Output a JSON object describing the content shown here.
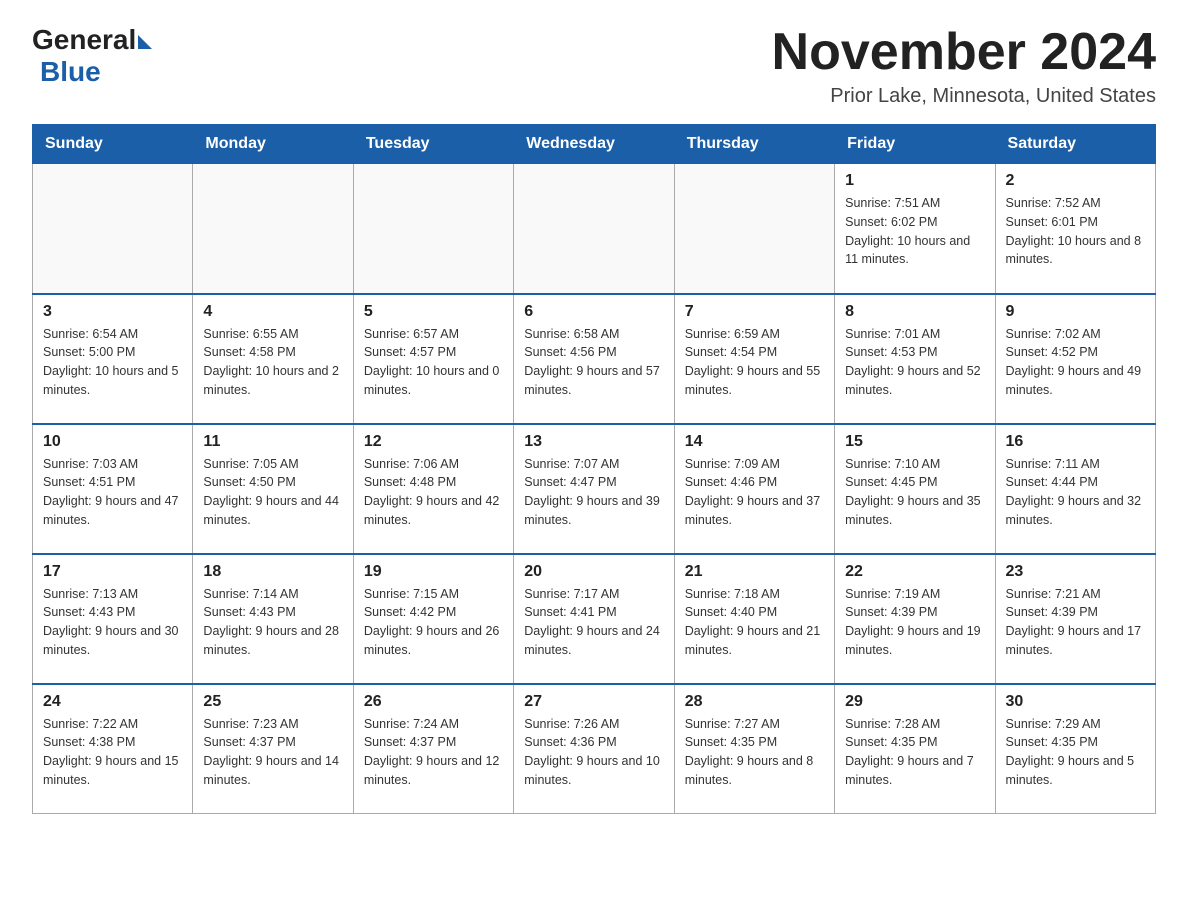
{
  "logo": {
    "general": "General",
    "blue": "Blue"
  },
  "title": "November 2024",
  "location": "Prior Lake, Minnesota, United States",
  "weekdays": [
    "Sunday",
    "Monday",
    "Tuesday",
    "Wednesday",
    "Thursday",
    "Friday",
    "Saturday"
  ],
  "weeks": [
    [
      {
        "day": "",
        "sunrise": "",
        "sunset": "",
        "daylight": ""
      },
      {
        "day": "",
        "sunrise": "",
        "sunset": "",
        "daylight": ""
      },
      {
        "day": "",
        "sunrise": "",
        "sunset": "",
        "daylight": ""
      },
      {
        "day": "",
        "sunrise": "",
        "sunset": "",
        "daylight": ""
      },
      {
        "day": "",
        "sunrise": "",
        "sunset": "",
        "daylight": ""
      },
      {
        "day": "1",
        "sunrise": "Sunrise: 7:51 AM",
        "sunset": "Sunset: 6:02 PM",
        "daylight": "Daylight: 10 hours and 11 minutes."
      },
      {
        "day": "2",
        "sunrise": "Sunrise: 7:52 AM",
        "sunset": "Sunset: 6:01 PM",
        "daylight": "Daylight: 10 hours and 8 minutes."
      }
    ],
    [
      {
        "day": "3",
        "sunrise": "Sunrise: 6:54 AM",
        "sunset": "Sunset: 5:00 PM",
        "daylight": "Daylight: 10 hours and 5 minutes."
      },
      {
        "day": "4",
        "sunrise": "Sunrise: 6:55 AM",
        "sunset": "Sunset: 4:58 PM",
        "daylight": "Daylight: 10 hours and 2 minutes."
      },
      {
        "day": "5",
        "sunrise": "Sunrise: 6:57 AM",
        "sunset": "Sunset: 4:57 PM",
        "daylight": "Daylight: 10 hours and 0 minutes."
      },
      {
        "day": "6",
        "sunrise": "Sunrise: 6:58 AM",
        "sunset": "Sunset: 4:56 PM",
        "daylight": "Daylight: 9 hours and 57 minutes."
      },
      {
        "day": "7",
        "sunrise": "Sunrise: 6:59 AM",
        "sunset": "Sunset: 4:54 PM",
        "daylight": "Daylight: 9 hours and 55 minutes."
      },
      {
        "day": "8",
        "sunrise": "Sunrise: 7:01 AM",
        "sunset": "Sunset: 4:53 PM",
        "daylight": "Daylight: 9 hours and 52 minutes."
      },
      {
        "day": "9",
        "sunrise": "Sunrise: 7:02 AM",
        "sunset": "Sunset: 4:52 PM",
        "daylight": "Daylight: 9 hours and 49 minutes."
      }
    ],
    [
      {
        "day": "10",
        "sunrise": "Sunrise: 7:03 AM",
        "sunset": "Sunset: 4:51 PM",
        "daylight": "Daylight: 9 hours and 47 minutes."
      },
      {
        "day": "11",
        "sunrise": "Sunrise: 7:05 AM",
        "sunset": "Sunset: 4:50 PM",
        "daylight": "Daylight: 9 hours and 44 minutes."
      },
      {
        "day": "12",
        "sunrise": "Sunrise: 7:06 AM",
        "sunset": "Sunset: 4:48 PM",
        "daylight": "Daylight: 9 hours and 42 minutes."
      },
      {
        "day": "13",
        "sunrise": "Sunrise: 7:07 AM",
        "sunset": "Sunset: 4:47 PM",
        "daylight": "Daylight: 9 hours and 39 minutes."
      },
      {
        "day": "14",
        "sunrise": "Sunrise: 7:09 AM",
        "sunset": "Sunset: 4:46 PM",
        "daylight": "Daylight: 9 hours and 37 minutes."
      },
      {
        "day": "15",
        "sunrise": "Sunrise: 7:10 AM",
        "sunset": "Sunset: 4:45 PM",
        "daylight": "Daylight: 9 hours and 35 minutes."
      },
      {
        "day": "16",
        "sunrise": "Sunrise: 7:11 AM",
        "sunset": "Sunset: 4:44 PM",
        "daylight": "Daylight: 9 hours and 32 minutes."
      }
    ],
    [
      {
        "day": "17",
        "sunrise": "Sunrise: 7:13 AM",
        "sunset": "Sunset: 4:43 PM",
        "daylight": "Daylight: 9 hours and 30 minutes."
      },
      {
        "day": "18",
        "sunrise": "Sunrise: 7:14 AM",
        "sunset": "Sunset: 4:43 PM",
        "daylight": "Daylight: 9 hours and 28 minutes."
      },
      {
        "day": "19",
        "sunrise": "Sunrise: 7:15 AM",
        "sunset": "Sunset: 4:42 PM",
        "daylight": "Daylight: 9 hours and 26 minutes."
      },
      {
        "day": "20",
        "sunrise": "Sunrise: 7:17 AM",
        "sunset": "Sunset: 4:41 PM",
        "daylight": "Daylight: 9 hours and 24 minutes."
      },
      {
        "day": "21",
        "sunrise": "Sunrise: 7:18 AM",
        "sunset": "Sunset: 4:40 PM",
        "daylight": "Daylight: 9 hours and 21 minutes."
      },
      {
        "day": "22",
        "sunrise": "Sunrise: 7:19 AM",
        "sunset": "Sunset: 4:39 PM",
        "daylight": "Daylight: 9 hours and 19 minutes."
      },
      {
        "day": "23",
        "sunrise": "Sunrise: 7:21 AM",
        "sunset": "Sunset: 4:39 PM",
        "daylight": "Daylight: 9 hours and 17 minutes."
      }
    ],
    [
      {
        "day": "24",
        "sunrise": "Sunrise: 7:22 AM",
        "sunset": "Sunset: 4:38 PM",
        "daylight": "Daylight: 9 hours and 15 minutes."
      },
      {
        "day": "25",
        "sunrise": "Sunrise: 7:23 AM",
        "sunset": "Sunset: 4:37 PM",
        "daylight": "Daylight: 9 hours and 14 minutes."
      },
      {
        "day": "26",
        "sunrise": "Sunrise: 7:24 AM",
        "sunset": "Sunset: 4:37 PM",
        "daylight": "Daylight: 9 hours and 12 minutes."
      },
      {
        "day": "27",
        "sunrise": "Sunrise: 7:26 AM",
        "sunset": "Sunset: 4:36 PM",
        "daylight": "Daylight: 9 hours and 10 minutes."
      },
      {
        "day": "28",
        "sunrise": "Sunrise: 7:27 AM",
        "sunset": "Sunset: 4:35 PM",
        "daylight": "Daylight: 9 hours and 8 minutes."
      },
      {
        "day": "29",
        "sunrise": "Sunrise: 7:28 AM",
        "sunset": "Sunset: 4:35 PM",
        "daylight": "Daylight: 9 hours and 7 minutes."
      },
      {
        "day": "30",
        "sunrise": "Sunrise: 7:29 AM",
        "sunset": "Sunset: 4:35 PM",
        "daylight": "Daylight: 9 hours and 5 minutes."
      }
    ]
  ]
}
